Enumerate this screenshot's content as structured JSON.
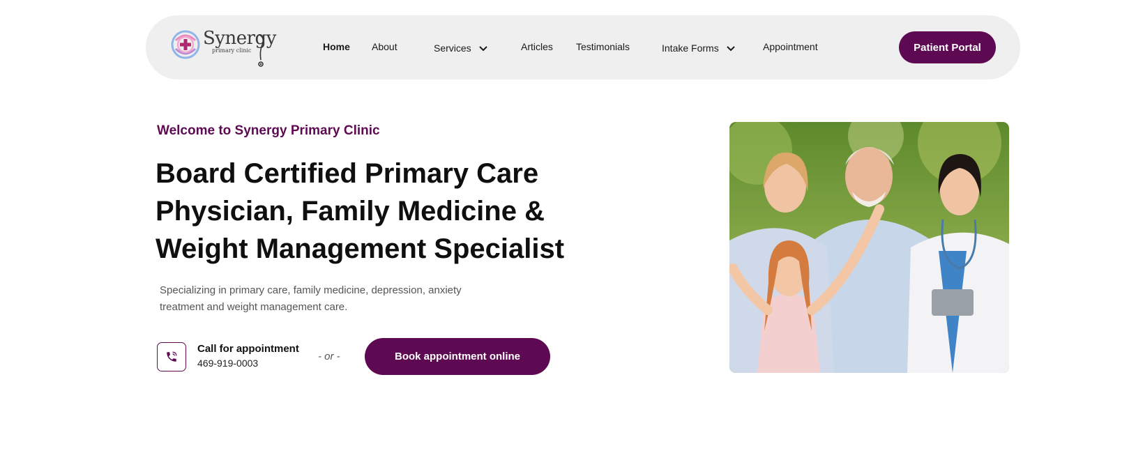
{
  "header": {
    "logo": {
      "word": "Synergy",
      "tagline": "primary clinic"
    },
    "nav": [
      {
        "label": "Home",
        "active": true
      },
      {
        "label": "About"
      },
      {
        "label": "Services",
        "has_dropdown": true
      },
      {
        "label": "Articles"
      },
      {
        "label": "Testimonials"
      },
      {
        "label": "Intake Forms",
        "has_dropdown": true
      },
      {
        "label": "Appointment"
      }
    ],
    "portal_button": "Patient Portal"
  },
  "hero": {
    "welcome": "Welcome to Synergy Primary Clinic",
    "headline_lines": [
      "Board Certified Primary Care",
      "Physician, Family Medicine &",
      "Weight Management Specialist"
    ],
    "subtext_lines": [
      "Specializing in primary care, family medicine, depression, anxiety",
      "treatment and weight management care."
    ],
    "call_label": "Call for appointment",
    "phone": "469-919-0003",
    "or_text": "- or -",
    "book_button": "Book appointment online",
    "image_icon": "family-with-doctor-photo"
  },
  "colors": {
    "brand": "#5e0a52",
    "nav_bg": "#efefef",
    "text_dark": "#0f0f0f",
    "text_muted": "#555555"
  }
}
